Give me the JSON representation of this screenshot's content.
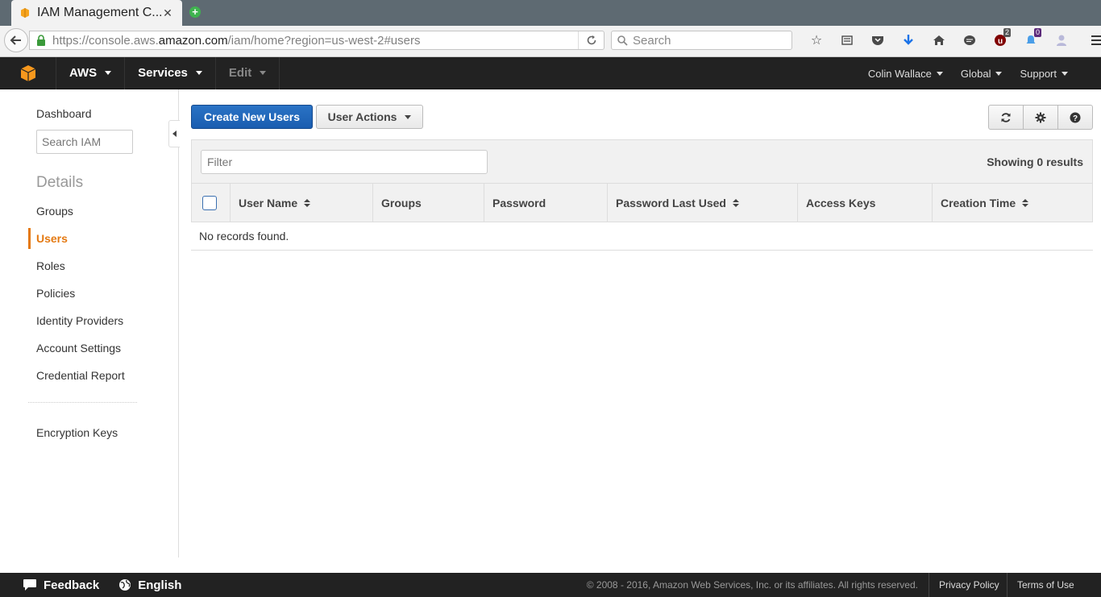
{
  "browser": {
    "tab_title": "IAM Management C...",
    "url_prefix": "https://console.aws.",
    "url_domain": "amazon.com",
    "url_path": "/iam/home?region=us-west-2#users",
    "search_placeholder": "Search",
    "badge_ublock": "2",
    "badge_notify": "0"
  },
  "aws_nav": {
    "brand": "AWS",
    "services": "Services",
    "edit": "Edit",
    "user": "Colin Wallace",
    "region": "Global",
    "support": "Support"
  },
  "sidebar": {
    "dashboard": "Dashboard",
    "search_placeholder": "Search IAM",
    "details_heading": "Details",
    "items": [
      "Groups",
      "Users",
      "Roles",
      "Policies",
      "Identity Providers",
      "Account Settings",
      "Credential Report"
    ],
    "encryption": "Encryption Keys"
  },
  "main": {
    "create_button": "Create New Users",
    "actions_button": "User Actions",
    "filter_placeholder": "Filter",
    "results_text": "Showing 0 results",
    "columns": [
      "User Name",
      "Groups",
      "Password",
      "Password Last Used",
      "Access Keys",
      "Creation Time"
    ],
    "empty_text": "No records found."
  },
  "footer": {
    "feedback": "Feedback",
    "language": "English",
    "copyright": "© 2008 - 2016, Amazon Web Services, Inc. or its affiliates. All rights reserved.",
    "privacy": "Privacy Policy",
    "terms": "Terms of Use"
  },
  "colors": {
    "accent_orange": "#e47911",
    "primary_blue": "#1a5db0",
    "nav_dark": "#222222"
  }
}
